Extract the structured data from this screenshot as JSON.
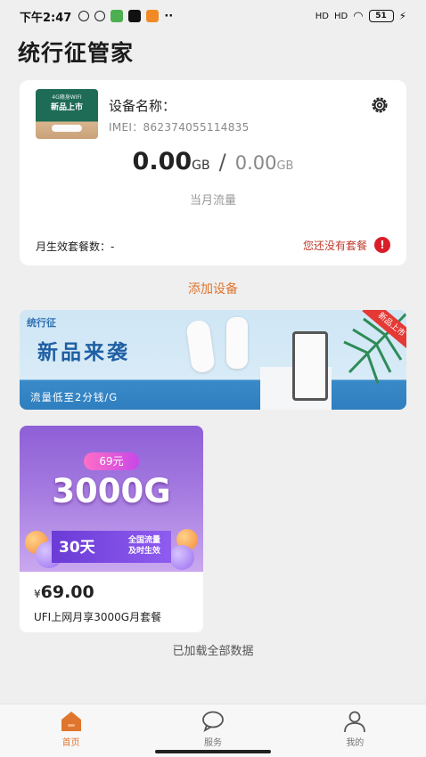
{
  "status_bar": {
    "time": "下午2:47",
    "signal1": "HD",
    "signal2": "HD",
    "battery": "51"
  },
  "app_title": "统行征管家",
  "device": {
    "thumb_line1": "4G随身WIFI",
    "thumb_line2": "新品上市",
    "name_label": "设备名称：",
    "imei_label": "IMEI：",
    "imei_value": "862374055114835",
    "used": "0.00",
    "used_unit": "GB",
    "total": "0.00",
    "total_unit": "GB",
    "separator": "/",
    "month_label": "当月流量",
    "pkg_count_label": "月生效套餐数：-",
    "no_pkg_text": "您还没有套餐",
    "alert_symbol": "!"
  },
  "add_device_label": "添加设备",
  "banner": {
    "logo": "统行征",
    "headline": "新品来袭",
    "subtitle": "流量低至2分钱/G",
    "ribbon": "新品上市"
  },
  "product": {
    "badge": "69元",
    "big_text": "3000G",
    "days": "30天",
    "tag_line1": "全国流量",
    "tag_line2": "及时生效",
    "currency": "¥",
    "price": "69.00",
    "name": "UFI上网月享3000G月套餐"
  },
  "loaded_text": "已加载全部数据",
  "tabs": [
    {
      "label": "首页",
      "icon": "home-icon",
      "active": true
    },
    {
      "label": "服务",
      "icon": "chat-icon",
      "active": false
    },
    {
      "label": "我的",
      "icon": "person-icon",
      "active": false
    }
  ],
  "colors": {
    "accent": "#e0762d",
    "alert": "#d91e2a",
    "banner_blue": "#1f5fa3",
    "product_purple": "#8e5fd6"
  }
}
